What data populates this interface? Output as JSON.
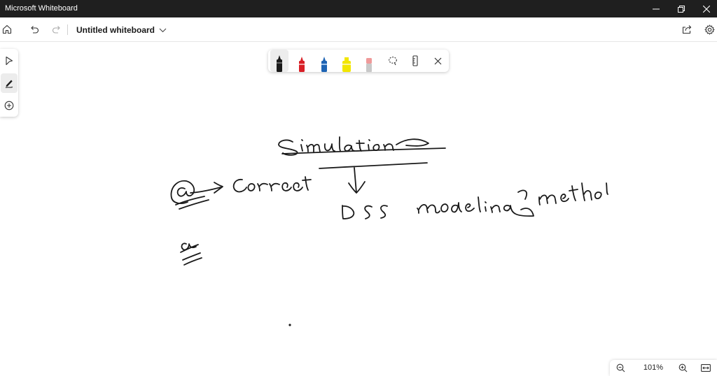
{
  "window": {
    "title": "Microsoft Whiteboard",
    "controls": [
      "minimize-icon",
      "restore-icon",
      "close-icon"
    ]
  },
  "appbar": {
    "board_title": "Untitled whiteboard",
    "left_icons": [
      "home-icon",
      "undo-icon",
      "redo-icon"
    ],
    "right_icons": [
      "share-icon",
      "settings-icon"
    ]
  },
  "left_toolbar": {
    "tools": [
      "select-icon",
      "inking-icon",
      "add-icon"
    ],
    "active_tool": "inking"
  },
  "ink_toolbar": {
    "pens": [
      {
        "name": "black",
        "color": "#1a1a1a",
        "selected": true
      },
      {
        "name": "red",
        "color": "#d81f26",
        "selected": false
      },
      {
        "name": "blue",
        "color": "#1e64b4",
        "selected": false
      },
      {
        "name": "highlighter-yellow",
        "color": "#f2e600",
        "selected": false
      },
      {
        "name": "eraser",
        "color": "#ef9a9a",
        "selected": false
      }
    ],
    "tools": [
      "lasso-icon",
      "ruler-icon",
      "close-icon"
    ]
  },
  "zoom": {
    "level": "101%",
    "controls": [
      "zoom-out-icon",
      "zoom-in-icon",
      "fit-to-screen-icon"
    ]
  },
  "canvas": {
    "ink_color": "#1a1a1a",
    "handwriting": [
      "Simulation",
      "@→ Correct",
      "DSS",
      "modeling method"
    ]
  }
}
